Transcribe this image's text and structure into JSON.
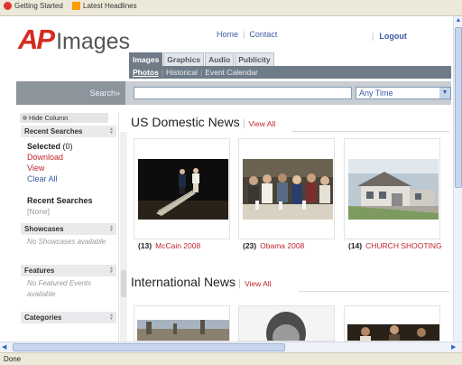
{
  "browser": {
    "bookmarks": [
      "Getting Started",
      "Latest Headlines"
    ],
    "status_text": "Done"
  },
  "header": {
    "logo_ap": "AP",
    "logo_images": "Images",
    "nav_home": "Home",
    "nav_contact": "Contact",
    "logout": "Logout"
  },
  "tabs": [
    {
      "label": "Images",
      "active": true
    },
    {
      "label": "Graphics",
      "active": false
    },
    {
      "label": "Audio",
      "active": false
    },
    {
      "label": "Publicity",
      "active": false
    }
  ],
  "subnav": {
    "photos": "Photos",
    "historical": "Historical",
    "event_calendar": "Event Calendar"
  },
  "search": {
    "label": "Search»",
    "query": "",
    "time_filter": "Any Time"
  },
  "sidebar": {
    "hide_column": "Hide Column",
    "recent_searches_header": "Recent Searches",
    "selected_label": "Selected",
    "selected_count": "(0)",
    "download": "Download",
    "view": "View",
    "clear_all": "Clear All",
    "recent_searches_title": "Recent Searches",
    "recent_searches_value": "[None]",
    "showcases_header": "Showcases",
    "showcases_empty": "No Showcases available",
    "features_header": "Features",
    "features_empty": "No Featured Events available",
    "categories_header": "Categories"
  },
  "sections": [
    {
      "title": "US Domestic News",
      "view_all": "View All",
      "items": [
        {
          "count": "(13)",
          "label": "McCain 2008"
        },
        {
          "count": "(23)",
          "label": "Obama 2008"
        },
        {
          "count": "(14)",
          "label": "CHURCH SHOOTING"
        }
      ]
    },
    {
      "title": "International News",
      "view_all": "View All"
    }
  ],
  "colors": {
    "ap_red": "#d52b1e",
    "link_red": "#c0262d",
    "link_blue": "#3a5aa3",
    "tab_active": "#6f7b86"
  }
}
